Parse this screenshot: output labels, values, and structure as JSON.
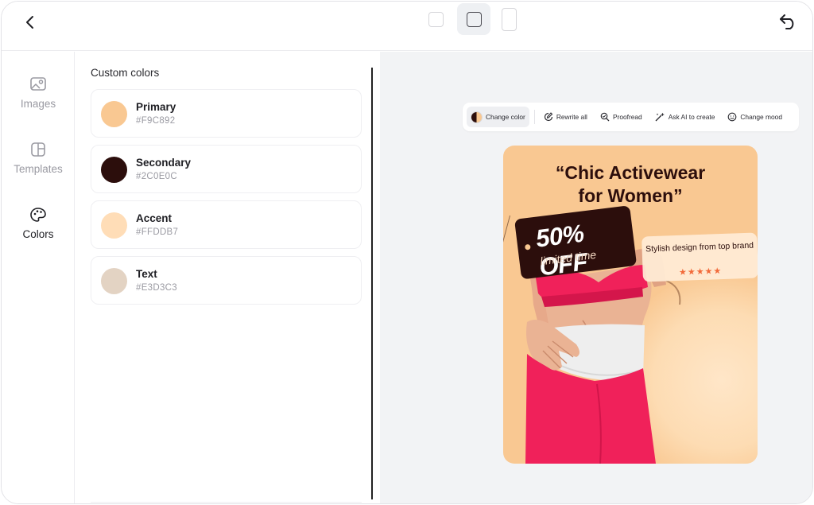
{
  "topbar": {
    "back_icon": "chevron-left-icon",
    "undo_icon": "undo-icon",
    "canvas_sizes": [
      "small-square",
      "square",
      "portrait"
    ]
  },
  "rail": {
    "items": [
      {
        "label": "Images",
        "icon": "image-icon"
      },
      {
        "label": "Templates",
        "icon": "templates-icon"
      },
      {
        "label": "Colors",
        "icon": "palette-icon",
        "active": true
      }
    ]
  },
  "panel": {
    "title": "Custom colors",
    "colors": [
      {
        "name": "Primary",
        "hex": "#F9C892"
      },
      {
        "name": "Secondary",
        "hex": "#2C0E0C"
      },
      {
        "name": "Accent",
        "hex": "#FFDDB7"
      },
      {
        "name": "Text",
        "hex": "#E3D3C3"
      }
    ]
  },
  "toolbar": {
    "change_color": "Change color",
    "rewrite_all": "Rewrite all",
    "proofread": "Proofread",
    "ask_ai": "Ask AI to create",
    "change_mood": "Change mood"
  },
  "poster": {
    "title_line1": "“Chic Activewear",
    "title_line2": "for Women”",
    "offer": "50% OFF",
    "offer_sub": "limited time",
    "rating_text": "Stylish design from top brand",
    "stars": "★★★★★",
    "rating_value": 5,
    "rating_max": 5
  },
  "colors": {
    "primary": "#F9C892",
    "secondary": "#2C0E0C",
    "accent": "#FFDDB7",
    "text": "#E3D3C3",
    "activewear": "#F0215A"
  }
}
